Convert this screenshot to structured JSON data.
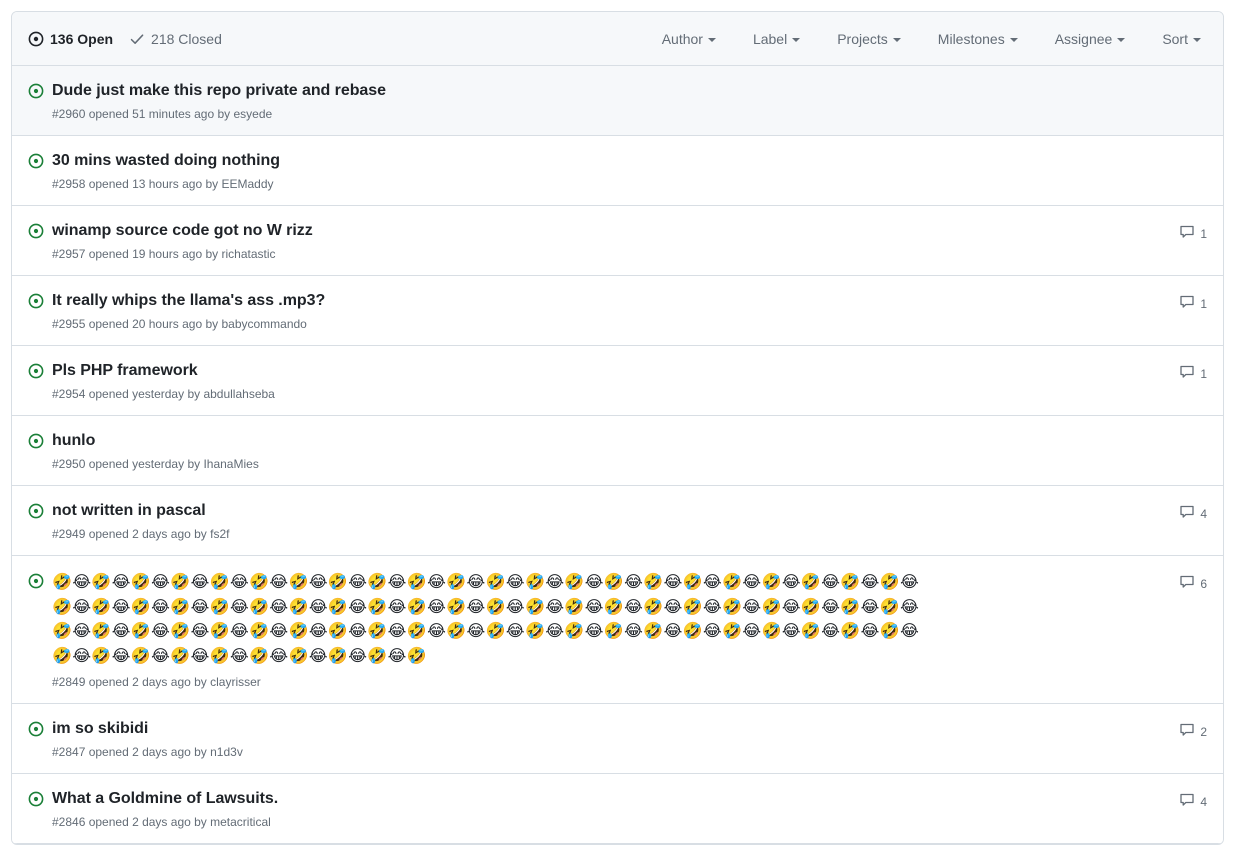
{
  "header": {
    "open_count_label": "136 Open",
    "closed_count_label": "218 Closed",
    "open_icon": "issue-opened-icon",
    "closed_icon": "check-icon",
    "filters": [
      {
        "label": "Author",
        "name": "author"
      },
      {
        "label": "Label",
        "name": "label"
      },
      {
        "label": "Projects",
        "name": "projects"
      },
      {
        "label": "Milestones",
        "name": "milestones"
      },
      {
        "label": "Assignee",
        "name": "assignee"
      },
      {
        "label": "Sort",
        "name": "sort"
      }
    ]
  },
  "colors": {
    "open_green": "#1a7f37",
    "border": "#d8dee4",
    "header_bg": "#f6f8fa",
    "muted_text": "#636c76",
    "primary_text": "#1f2328"
  },
  "issues": [
    {
      "title": "Dude just make this repo private and rebase",
      "meta": "#2960 opened 51 minutes ago by esyede",
      "number": "#2960",
      "opened": "51 minutes ago",
      "author": "esyede",
      "comments": "",
      "state": "open",
      "highlighted": true
    },
    {
      "title": "30 mins wasted doing nothing",
      "meta": "#2958 opened 13 hours ago by EEMaddy",
      "number": "#2958",
      "opened": "13 hours ago",
      "author": "EEMaddy",
      "comments": "",
      "state": "open",
      "highlighted": false
    },
    {
      "title": "winamp source code got no W rizz",
      "meta": "#2957 opened 19 hours ago by richatastic",
      "number": "#2957",
      "opened": "19 hours ago",
      "author": "richatastic",
      "comments": "1",
      "state": "open",
      "highlighted": false
    },
    {
      "title": "It really whips the llama's ass .mp3?",
      "meta": "#2955 opened 20 hours ago by babycommando",
      "number": "#2955",
      "opened": "20 hours ago",
      "author": "babycommando",
      "comments": "1",
      "state": "open",
      "highlighted": false
    },
    {
      "title": "Pls PHP framework",
      "meta": "#2954 opened yesterday by abdullahseba",
      "number": "#2954",
      "opened": "yesterday",
      "author": "abdullahseba",
      "comments": "1",
      "state": "open",
      "highlighted": false
    },
    {
      "title": "hunlo",
      "meta": "#2950 opened yesterday by IhanaMies",
      "number": "#2950",
      "opened": "yesterday",
      "author": "IhanaMies",
      "comments": "",
      "state": "open",
      "highlighted": false
    },
    {
      "title": "not written in pascal",
      "meta": "#2949 opened 2 days ago by fs2f",
      "number": "#2949",
      "opened": "2 days ago",
      "author": "fs2f",
      "comments": "4",
      "state": "open",
      "highlighted": false
    },
    {
      "title": "🤣😂🤣😂🤣😂🤣😂🤣😂🤣😂🤣😂🤣😂🤣😂🤣😂🤣😂🤣😂🤣😂🤣😂🤣😂🤣😂🤣😂🤣😂🤣😂🤣😂🤣😂🤣😂🤣😂🤣😂🤣😂🤣😂🤣😂🤣😂🤣😂🤣😂🤣😂🤣😂🤣😂🤣😂🤣😂🤣😂🤣😂🤣😂🤣😂🤣😂🤣😂🤣😂🤣😂🤣😂🤣😂🤣😂🤣😂🤣😂🤣😂🤣😂🤣😂🤣😂🤣😂🤣😂🤣😂🤣😂🤣😂🤣😂🤣😂🤣😂🤣😂🤣😂🤣😂🤣😂🤣😂🤣😂🤣😂🤣😂🤣😂🤣😂🤣😂🤣😂🤣😂🤣😂🤣😂🤣",
      "meta": "#2849 opened 2 days ago by clayrisser",
      "number": "#2849",
      "opened": "2 days ago",
      "author": "clayrisser",
      "comments": "6",
      "state": "open",
      "highlighted": false,
      "is_emoji": true
    },
    {
      "title": "im so skibidi",
      "meta": "#2847 opened 2 days ago by n1d3v",
      "number": "#2847",
      "opened": "2 days ago",
      "author": "n1d3v",
      "comments": "2",
      "state": "open",
      "highlighted": false
    },
    {
      "title": "What a Goldmine of Lawsuits.",
      "meta": "#2846 opened 2 days ago by metacritical",
      "number": "#2846",
      "opened": "2 days ago",
      "author": "metacritical",
      "comments": "4",
      "state": "open",
      "highlighted": false
    }
  ]
}
